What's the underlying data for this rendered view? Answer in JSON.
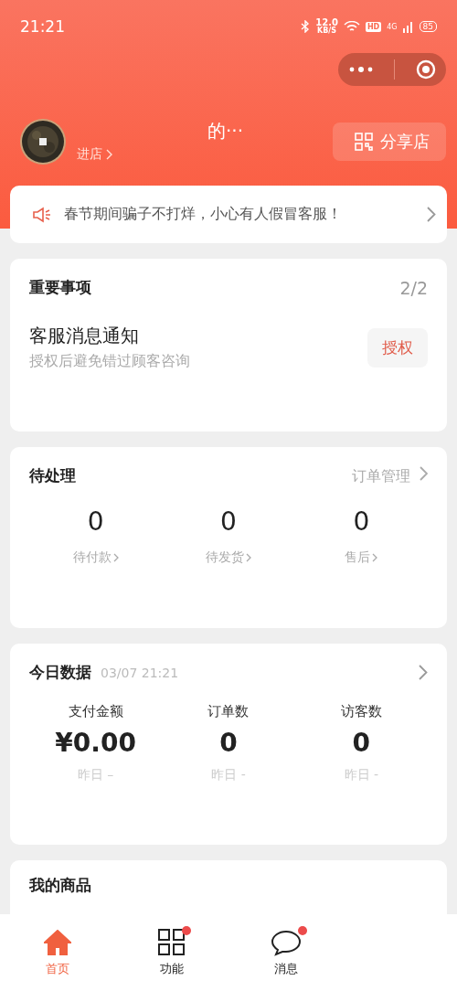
{
  "status_bar": {
    "time": "21:21",
    "speed": "12.0",
    "speed_unit": "KB/S",
    "hd": "HD",
    "network": "4G",
    "battery": "85"
  },
  "header": {
    "shop_name": "的···",
    "enter_link": "进店",
    "share_button": "分享店"
  },
  "notice": {
    "text": "春节期间骗子不打烊，小心有人假冒客服！"
  },
  "important": {
    "title": "重要事项",
    "count": "2/2",
    "item_title": "客服消息通知",
    "item_desc": "授权后避免错过顾客咨询",
    "action": "授权"
  },
  "pending": {
    "title": "待处理",
    "link": "订单管理",
    "stats": [
      {
        "value": "0",
        "label": "待付款"
      },
      {
        "value": "0",
        "label": "待发货"
      },
      {
        "value": "0",
        "label": "售后"
      }
    ]
  },
  "today": {
    "title": "今日数据",
    "time": "03/07 21:21",
    "stats": [
      {
        "label": "支付金额",
        "value": "¥0.00",
        "compare": "昨日 –"
      },
      {
        "label": "订单数",
        "value": "0",
        "compare": "昨日 -"
      },
      {
        "label": "访客数",
        "value": "0",
        "compare": "昨日 -"
      }
    ]
  },
  "goods": {
    "title": "我的商品"
  },
  "tabs": [
    {
      "kind": "home",
      "label": "首页",
      "selected": true,
      "badge": false
    },
    {
      "kind": "grid",
      "label": "功能",
      "selected": false,
      "badge": true
    },
    {
      "kind": "chat",
      "label": "消息",
      "selected": false,
      "badge": true
    }
  ]
}
